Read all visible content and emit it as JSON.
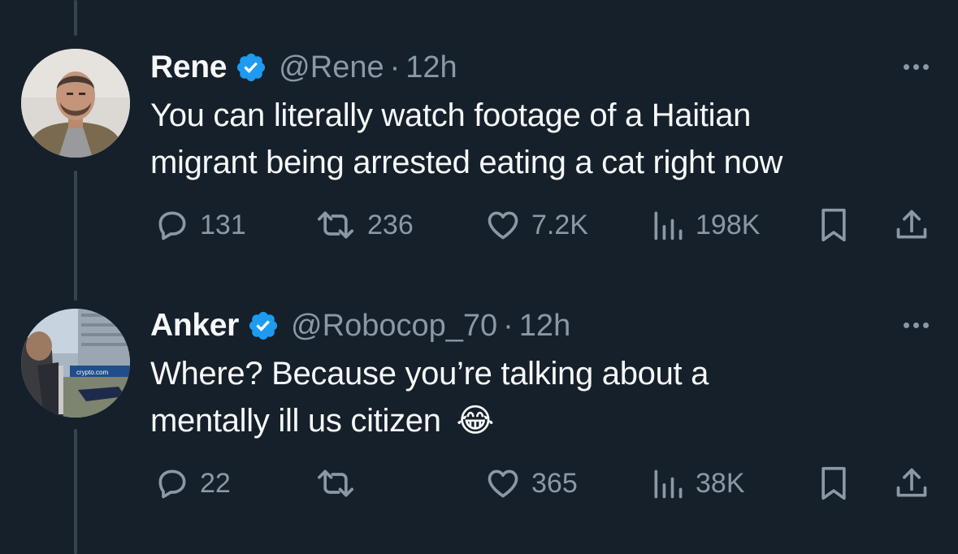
{
  "tweets": [
    {
      "name": "Rene",
      "handle": "@Rene",
      "separator": "·",
      "time": "12h",
      "text_line1": "You can literally watch footage of a Haitian",
      "text_line2": "migrant being arrested eating a cat right now",
      "emoji": "",
      "replies": "131",
      "retweets": "236",
      "likes": "7.2K",
      "views": "198K"
    },
    {
      "name": "Anker",
      "handle": "@Robocop_70",
      "separator": "·",
      "time": "12h",
      "text_line1": "Where? Because you’re talking about a",
      "text_line2": "mentally ill us citizen",
      "emoji": "😂",
      "replies": "22",
      "retweets": "",
      "likes": "365",
      "views": "38K"
    }
  ],
  "avatar_background_sign": "crypto.com",
  "colors": {
    "background": "#15202b",
    "text": "#f7f9f9",
    "secondary": "#8b98a5",
    "verified": "#1d9bf0",
    "thread_line": "#38444d"
  },
  "icons": [
    "verified-badge-icon",
    "more-icon",
    "reply-icon",
    "retweet-icon",
    "like-icon",
    "views-icon",
    "bookmark-icon",
    "share-icon"
  ]
}
